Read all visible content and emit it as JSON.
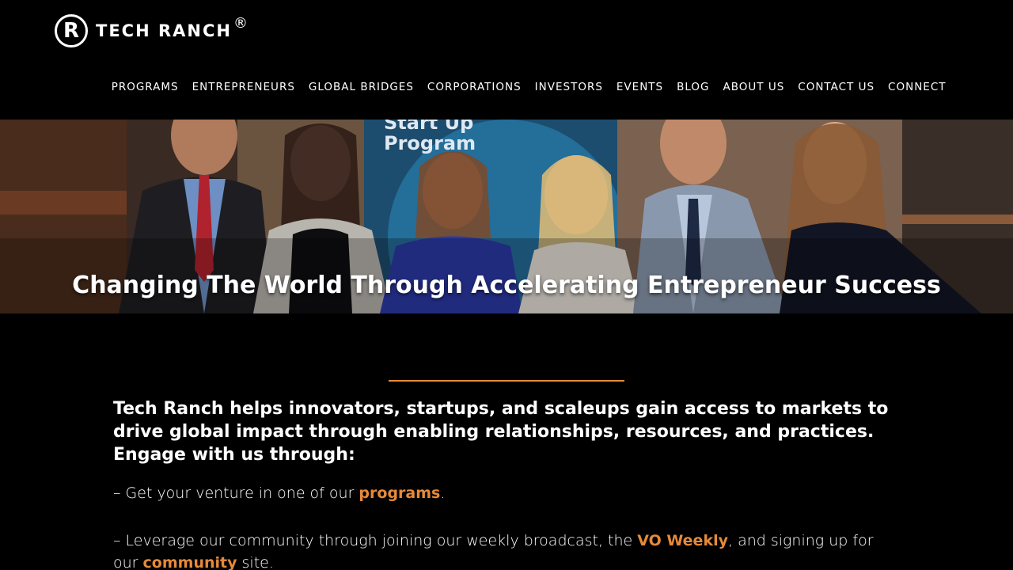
{
  "brand": {
    "logo_letter": "R",
    "name": "TECH RANCH",
    "registered_mark": "®"
  },
  "nav": {
    "items": [
      {
        "label": "PROGRAMS"
      },
      {
        "label": "ENTREPRENEURS"
      },
      {
        "label": "GLOBAL BRIDGES"
      },
      {
        "label": "CORPORATIONS"
      },
      {
        "label": "INVESTORS"
      },
      {
        "label": "EVENTS"
      },
      {
        "label": "BLOG"
      },
      {
        "label": "ABOUT US"
      },
      {
        "label": "CONTACT US"
      },
      {
        "label": "CONNECT"
      }
    ]
  },
  "hero": {
    "title": "Changing The World Through Accelerating Entrepreneur Success",
    "banner_text_1": "Start Up",
    "banner_text_2": "Program"
  },
  "content": {
    "lead": "Tech Ranch helps innovators, startups, and scaleups gain access to markets to drive global impact through enabling relationships, resources, and practices. Engage with us through:",
    "line1_prefix": "– Get your venture in one of our ",
    "line1_link": "programs",
    "line1_suffix": ".",
    "line2_prefix": "– Leverage our community through joining our weekly broadcast, the ",
    "line2_link1": "VO Weekly",
    "line2_middle": ", and signing up for our ",
    "line2_link2": "community",
    "line2_suffix": " site."
  },
  "colors": {
    "accent": "#e58a3a",
    "background": "#000000",
    "text": "#ffffff"
  }
}
